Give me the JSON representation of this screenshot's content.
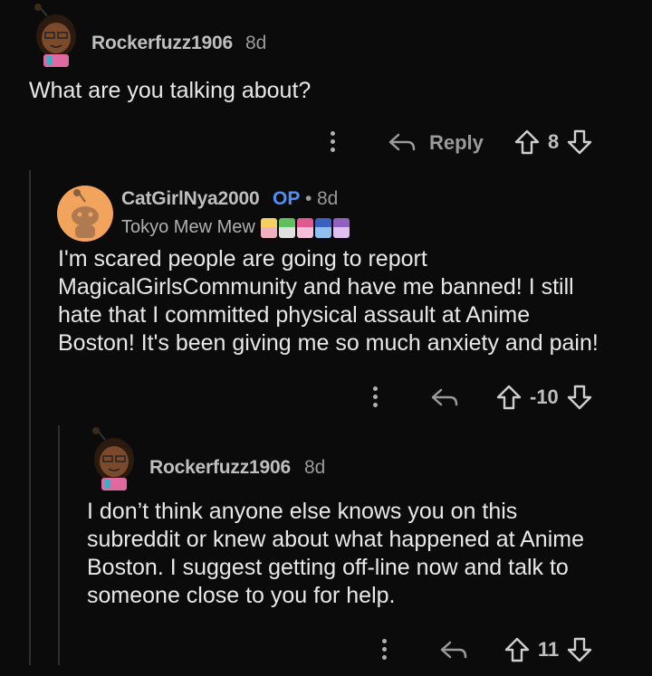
{
  "comments": [
    {
      "username": "Rockerfuzz1906",
      "age": "8d",
      "body": "What are you talking about?",
      "reply_label": "Reply",
      "score": "8"
    },
    {
      "username": "CatGirlNya2000",
      "op_badge": "OP",
      "separator": "•",
      "age": "8d",
      "flair_text": "Tokyo Mew Mew",
      "body_lines": [
        "I'm scared people are going to report",
        "MagicalGirlsCommunity and have me banned! I still",
        "hate that I committed physical assault at Anime",
        "Boston! It's been giving me so much anxiety and pain!"
      ],
      "score": "-10"
    },
    {
      "username": "Rockerfuzz1906",
      "age": "8d",
      "body_lines": [
        "I don’t think anyone else knows you on this",
        "subreddit or knew about what happened at Anime",
        "Boston. I suggest getting off-line now and talk to",
        "someone close to you for help."
      ],
      "score": "11"
    }
  ],
  "colors": {
    "background": "#0b0b0b",
    "op": "#4e8ef7",
    "avatar_orange": "#f2a35c"
  },
  "icons": [
    "overflow-dots-icon",
    "reply-arrow-icon",
    "upvote-icon",
    "downvote-icon",
    "snoo-avatar-icon",
    "flair-sprite-icon"
  ]
}
